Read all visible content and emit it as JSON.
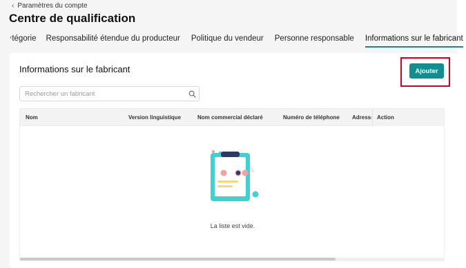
{
  "breadcrumb": {
    "label": "Paramètres du compte"
  },
  "page": {
    "title": "Centre de qualification"
  },
  "tabs": [
    {
      "label": "tégorie",
      "active": false
    },
    {
      "label": "Responsabilité étendue du producteur",
      "active": false
    },
    {
      "label": "Politique du vendeur",
      "active": false
    },
    {
      "label": "Personne responsable",
      "active": false
    },
    {
      "label": "Informations sur le fabricant",
      "active": true
    }
  ],
  "card": {
    "title": "Informations sur le fabricant",
    "add_label": "Ajouter"
  },
  "search": {
    "placeholder": "Rechercher un fabricant",
    "value": ""
  },
  "table": {
    "columns": [
      "Nom",
      "Version linguistique",
      "Nom commercial déclaré",
      "Numéro de téléphone",
      "Adresse",
      "Action"
    ],
    "rows": [],
    "empty_text": "La liste est vide."
  },
  "colors": {
    "accent": "#128e8e",
    "highlight": "#d8001b",
    "illustration_teal": "#3ed3d3",
    "illustration_pink": "#f3a0a0",
    "illustration_navy": "#2b3a67"
  }
}
